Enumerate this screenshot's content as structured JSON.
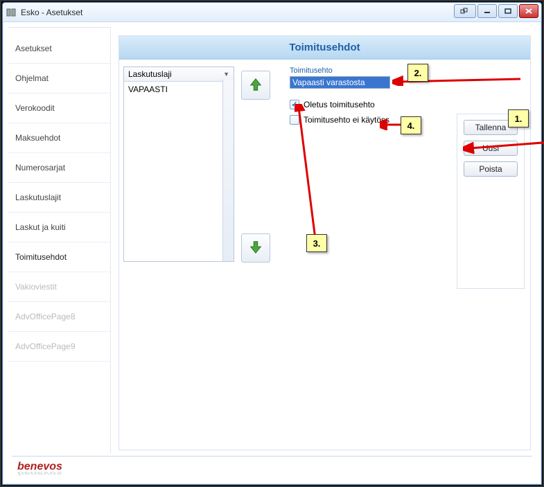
{
  "window": {
    "title": "Esko - Asetukset"
  },
  "sidebar": {
    "items": [
      {
        "label": "Asetukset",
        "state": "normal"
      },
      {
        "label": "Ohjelmat",
        "state": "normal"
      },
      {
        "label": "Verokoodit",
        "state": "normal"
      },
      {
        "label": "Maksuehdot",
        "state": "normal"
      },
      {
        "label": "Numerosarjat",
        "state": "normal"
      },
      {
        "label": "Laskutuslajit",
        "state": "normal"
      },
      {
        "label": "Laskut ja kuiti",
        "state": "normal"
      },
      {
        "label": "Toimitusehdot",
        "state": "active"
      },
      {
        "label": "Vakioviestit",
        "state": "disabled"
      },
      {
        "label": "AdvOfficePage8",
        "state": "disabled"
      },
      {
        "label": "AdvOfficePage9",
        "state": "disabled"
      }
    ]
  },
  "panel": {
    "title": "Toimitusehdot"
  },
  "listbox": {
    "header": "Laskutuslaji",
    "rows": [
      "VAPAASTI"
    ]
  },
  "form": {
    "label": "Toimitusehto",
    "value": "Vapaasti varastosta",
    "checkbox1_label": "Oletus toimitusehto",
    "checkbox1_checked": true,
    "checkbox2_label": "Toimitusehto ei käytöss",
    "checkbox2_checked": false
  },
  "buttons": {
    "save": "Tallenna",
    "new": "Uusi",
    "delete": "Poista"
  },
  "callouts": {
    "c1": "1.",
    "c2": "2.",
    "c3": "3.",
    "c4": "4."
  },
  "footer": {
    "brand": "benevos"
  }
}
